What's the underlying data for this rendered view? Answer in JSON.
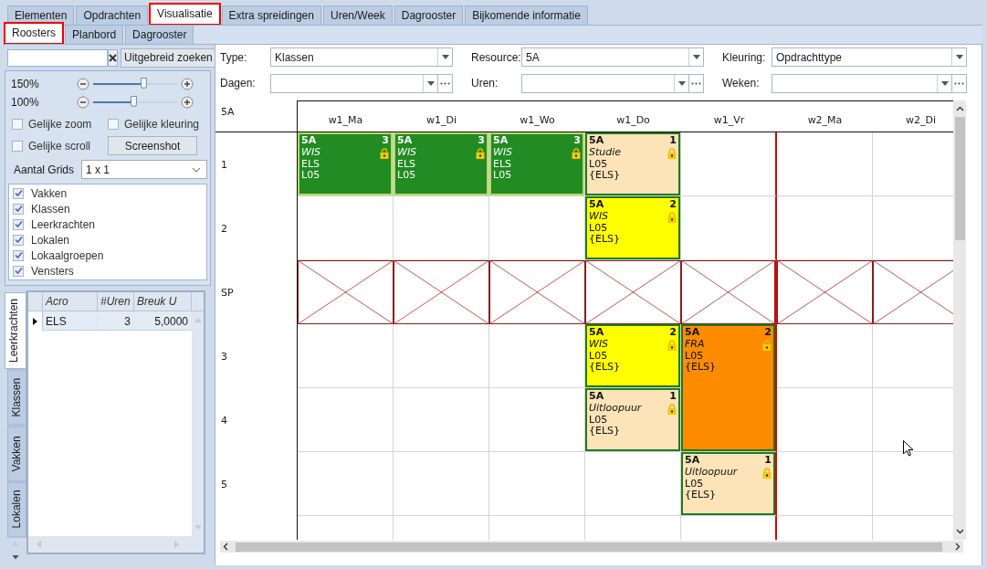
{
  "tabs": [
    {
      "label": "Elementen",
      "selected": false,
      "highlighted": false
    },
    {
      "label": "Opdrachten",
      "selected": false,
      "highlighted": false
    },
    {
      "label": "Visualisatie",
      "selected": true,
      "highlighted": true
    },
    {
      "label": "Extra spreidingen",
      "selected": false,
      "highlighted": false
    },
    {
      "label": "Uren/Week",
      "selected": false,
      "highlighted": false
    },
    {
      "label": "Dagrooster",
      "selected": false,
      "highlighted": false
    },
    {
      "label": "Bijkomende informatie",
      "selected": false,
      "highlighted": false
    }
  ],
  "subtabs": [
    {
      "label": "Roosters",
      "selected": true,
      "highlighted": true
    },
    {
      "label": "Planbord",
      "selected": false,
      "highlighted": false
    },
    {
      "label": "Dagrooster",
      "selected": false,
      "highlighted": false
    }
  ],
  "left_panel": {
    "search_button": "Uitgebreid zoeken",
    "zoom": [
      {
        "reading": "150%",
        "level": 0.6
      },
      {
        "reading": "100%",
        "level": 0.48
      }
    ],
    "options": [
      {
        "kind": "checkbox",
        "label": "Gelijke zoom",
        "checked": false
      },
      {
        "kind": "checkbox",
        "label": "Gelijke kleuring",
        "checked": false
      },
      {
        "kind": "checkbox",
        "label": "Gelijke scroll",
        "checked": false
      },
      {
        "kind": "button",
        "label": "Screenshot"
      }
    ],
    "grid_count": {
      "label": "Aantal Grids",
      "value": "1 x 1"
    },
    "elements": [
      {
        "label": "Vakken",
        "checked": true
      },
      {
        "label": "Klassen",
        "checked": true
      },
      {
        "label": "Leerkrachten",
        "checked": true
      },
      {
        "label": "Lokalen",
        "checked": true
      },
      {
        "label": "Lokaalgroepen",
        "checked": true
      },
      {
        "label": "Vensters",
        "checked": true
      }
    ],
    "side_tabs": [
      {
        "label": "Leerkrachten",
        "selected": true
      },
      {
        "label": "Klassen",
        "selected": false
      },
      {
        "label": "Vakken",
        "selected": false
      },
      {
        "label": "Lokalen",
        "selected": false
      }
    ],
    "table": {
      "columns": [
        "Acro",
        "#Uren",
        "Breuk U"
      ],
      "rows": [
        {
          "cells": [
            "ELS",
            "3",
            "5,0000"
          ],
          "selected": true
        }
      ]
    }
  },
  "filters": [
    {
      "kind": "combo",
      "label": "Type:",
      "value": "Klassen"
    },
    {
      "kind": "combo",
      "label": "Resource:",
      "value": "5A"
    },
    {
      "kind": "combo",
      "label": "Kleuring:",
      "value": "Opdrachttype"
    },
    {
      "kind": "picker",
      "label": "Dagen:"
    },
    {
      "kind": "picker",
      "label": "Uren:"
    },
    {
      "kind": "picker",
      "label": "Weken:"
    }
  ],
  "schedule": {
    "title": "5A",
    "weeks": [
      {
        "columns": [
          "w1_Ma",
          "w1_Di",
          "w1_Wo",
          "w1_Do",
          "w1_Vr"
        ]
      },
      {
        "columns": [
          "w2_Ma",
          "w2_Di"
        ]
      }
    ],
    "rows": [
      {
        "kind": "hour",
        "label": "1",
        "cells": [
          {
            "kind": "lesson",
            "color": "#228b22",
            "group": "5A",
            "count": "3",
            "subject": "WIS",
            "lines": [
              "ELS",
              "L05"
            ],
            "locked": true
          },
          {
            "kind": "lesson",
            "color": "#228b22",
            "group": "5A",
            "count": "3",
            "subject": "WIS",
            "lines": [
              "ELS",
              "L05"
            ],
            "locked": true
          },
          {
            "kind": "lesson",
            "color": "#228b22",
            "group": "5A",
            "count": "3",
            "subject": "WIS",
            "lines": [
              "ELS",
              "L05"
            ],
            "locked": true
          },
          {
            "kind": "lesson",
            "color": "#fde3b8",
            "group": "5A",
            "count": "1",
            "subject": "Studie",
            "lines": [
              "L05",
              "{ELS}"
            ],
            "locked": true
          },
          {
            "kind": "empty"
          },
          {
            "kind": "empty"
          },
          {
            "kind": "empty"
          }
        ]
      },
      {
        "kind": "hour",
        "label": "2",
        "cells": [
          {
            "kind": "empty"
          },
          {
            "kind": "empty"
          },
          {
            "kind": "empty"
          },
          {
            "kind": "lesson",
            "color": "#ffff00",
            "group": "5A",
            "count": "2",
            "subject": "WIS",
            "lines": [
              "L05",
              "{ELS}"
            ],
            "locked": true
          },
          {
            "kind": "empty"
          },
          {
            "kind": "empty"
          },
          {
            "kind": "empty"
          }
        ]
      },
      {
        "kind": "break",
        "label": "SP"
      },
      {
        "kind": "hour",
        "label": "3",
        "cells": [
          {
            "kind": "empty"
          },
          {
            "kind": "empty"
          },
          {
            "kind": "empty"
          },
          {
            "kind": "lesson",
            "color": "#ffff00",
            "group": "5A",
            "count": "2",
            "subject": "WIS",
            "lines": [
              "L05",
              "{ELS}"
            ],
            "locked": true
          },
          {
            "kind": "double",
            "color": "#ff8c00",
            "group": "5A",
            "count": "2",
            "subject": "FRA",
            "lines": [
              "L05",
              "{ELS}"
            ],
            "locked": true
          },
          {
            "kind": "empty"
          },
          {
            "kind": "empty"
          }
        ]
      },
      {
        "kind": "hour",
        "label": "4",
        "cells": [
          {
            "kind": "empty"
          },
          {
            "kind": "empty"
          },
          {
            "kind": "empty"
          },
          {
            "kind": "lesson",
            "color": "#fde3b8",
            "group": "5A",
            "count": "1",
            "subject": "Uitloopuur",
            "lines": [
              "L05",
              "{ELS}"
            ],
            "locked": true
          },
          {
            "kind": "covered"
          },
          {
            "kind": "empty"
          },
          {
            "kind": "empty"
          }
        ]
      },
      {
        "kind": "hour",
        "label": "5",
        "cells": [
          {
            "kind": "empty"
          },
          {
            "kind": "empty"
          },
          {
            "kind": "empty"
          },
          {
            "kind": "empty"
          },
          {
            "kind": "lesson",
            "color": "#fde3b8",
            "group": "5A",
            "count": "1",
            "subject": "Uitloopuur",
            "lines": [
              "L05",
              "{ELS}"
            ],
            "locked": true
          },
          {
            "kind": "empty"
          },
          {
            "kind": "empty"
          }
        ]
      },
      {
        "kind": "hour",
        "cells": [
          {
            "kind": "empty"
          },
          {
            "kind": "empty"
          },
          {
            "kind": "empty"
          },
          {
            "kind": "empty"
          },
          {
            "kind": "empty"
          },
          {
            "kind": "empty"
          },
          {
            "kind": "empty"
          }
        ]
      }
    ]
  }
}
